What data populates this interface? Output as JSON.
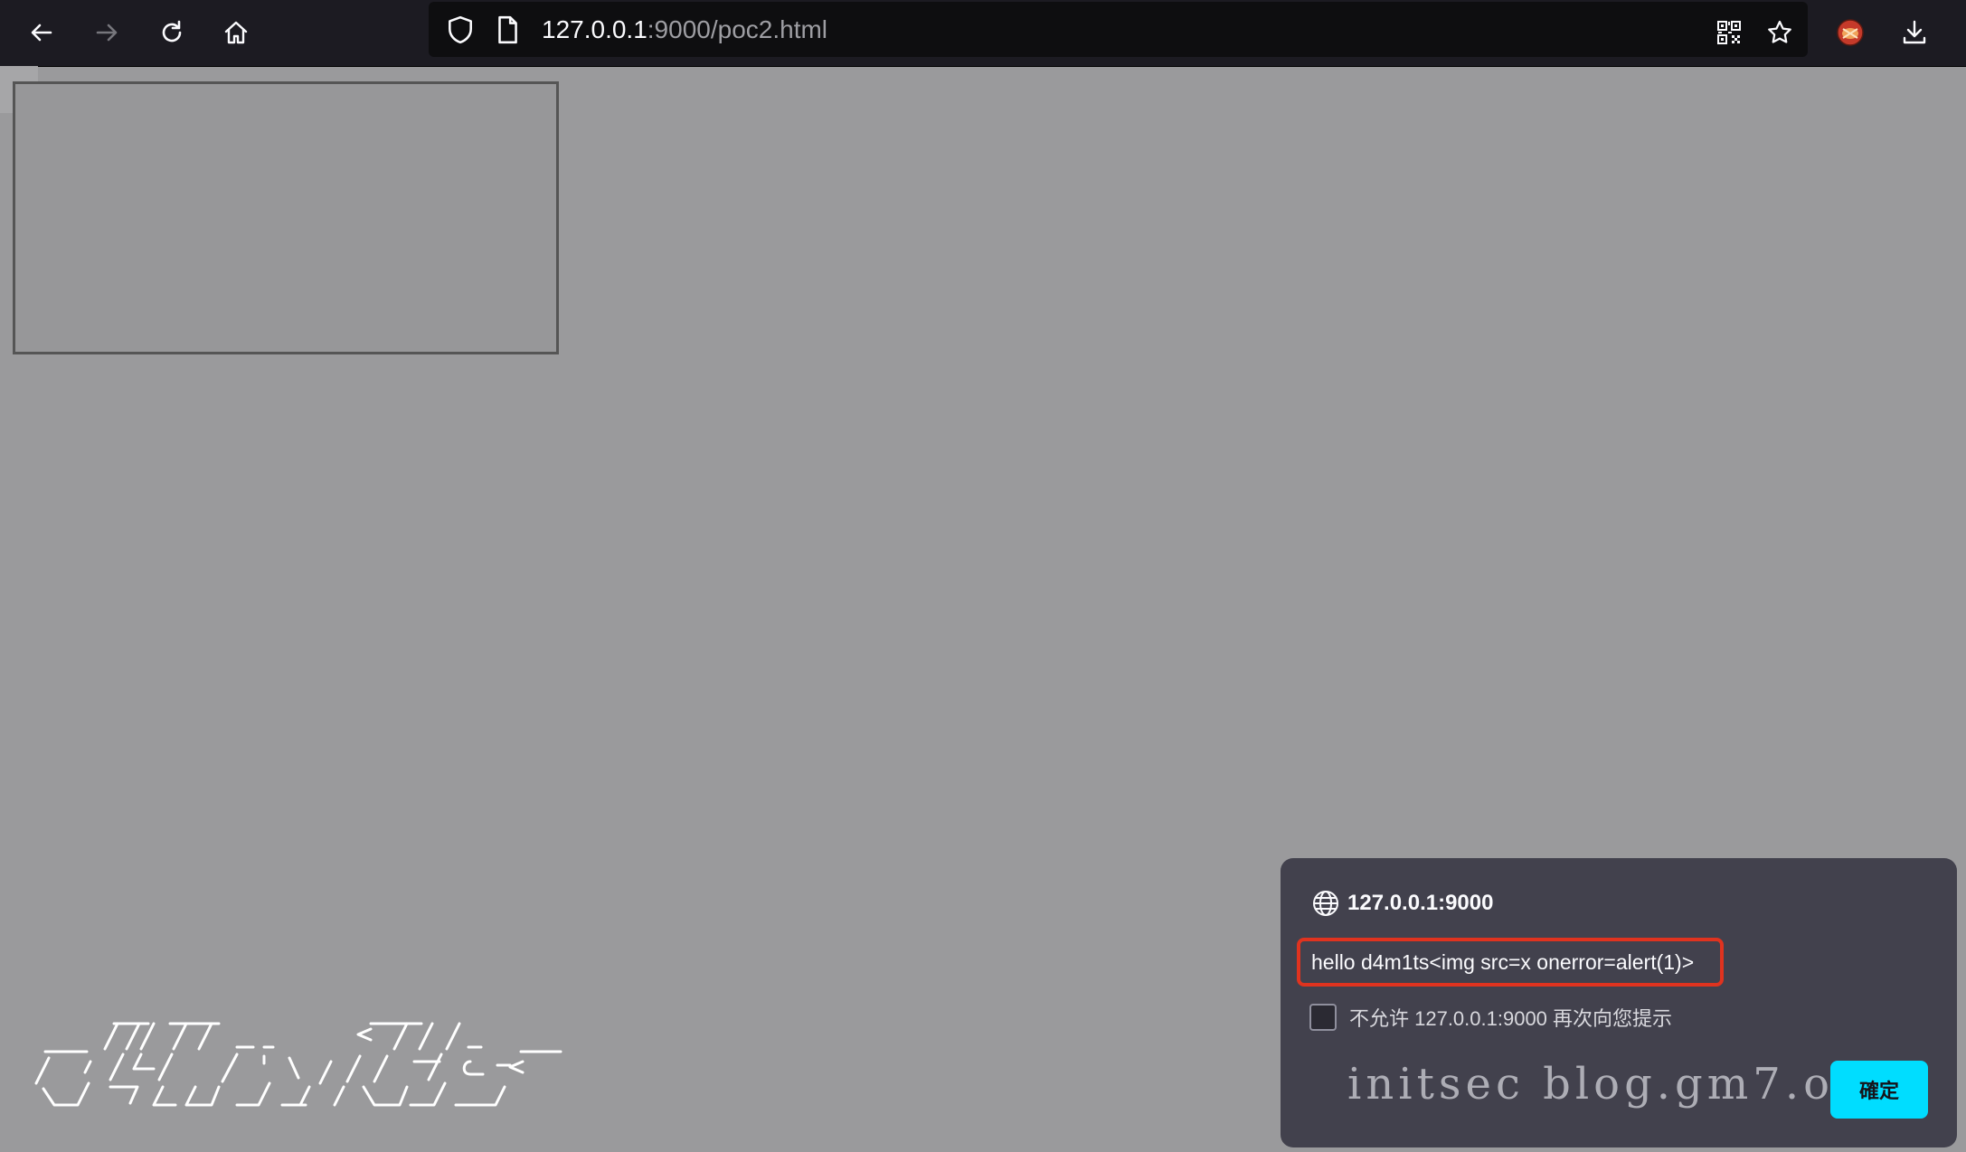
{
  "browser": {
    "url_host": "127.0.0.1",
    "url_path": ":9000/poc2.html",
    "buttons": {
      "back": "back-arrow-icon",
      "forward": "forward-arrow-icon",
      "reload": "reload-icon",
      "home": "home-icon",
      "qr": "qr-code-icon",
      "bookmark": "star-icon",
      "extension": "extension-avatar-icon",
      "downloads": "download-icon"
    }
  },
  "dialog": {
    "origin": "127.0.0.1:9000",
    "message": "hello d4m1ts<img src=x onerror=alert(1)>",
    "checkbox_label": "不允许 127.0.0.1:9000 再次向您提示",
    "checkbox_checked": false,
    "ok_label": "確定",
    "watermark": "initsec blog.gm7.org"
  },
  "colors": {
    "toolbar": "#1c1b22",
    "page_bg": "#9a9a9c",
    "dialog_bg": "#42414d",
    "accent": "#00ddff",
    "highlight_border": "#e0331f"
  }
}
